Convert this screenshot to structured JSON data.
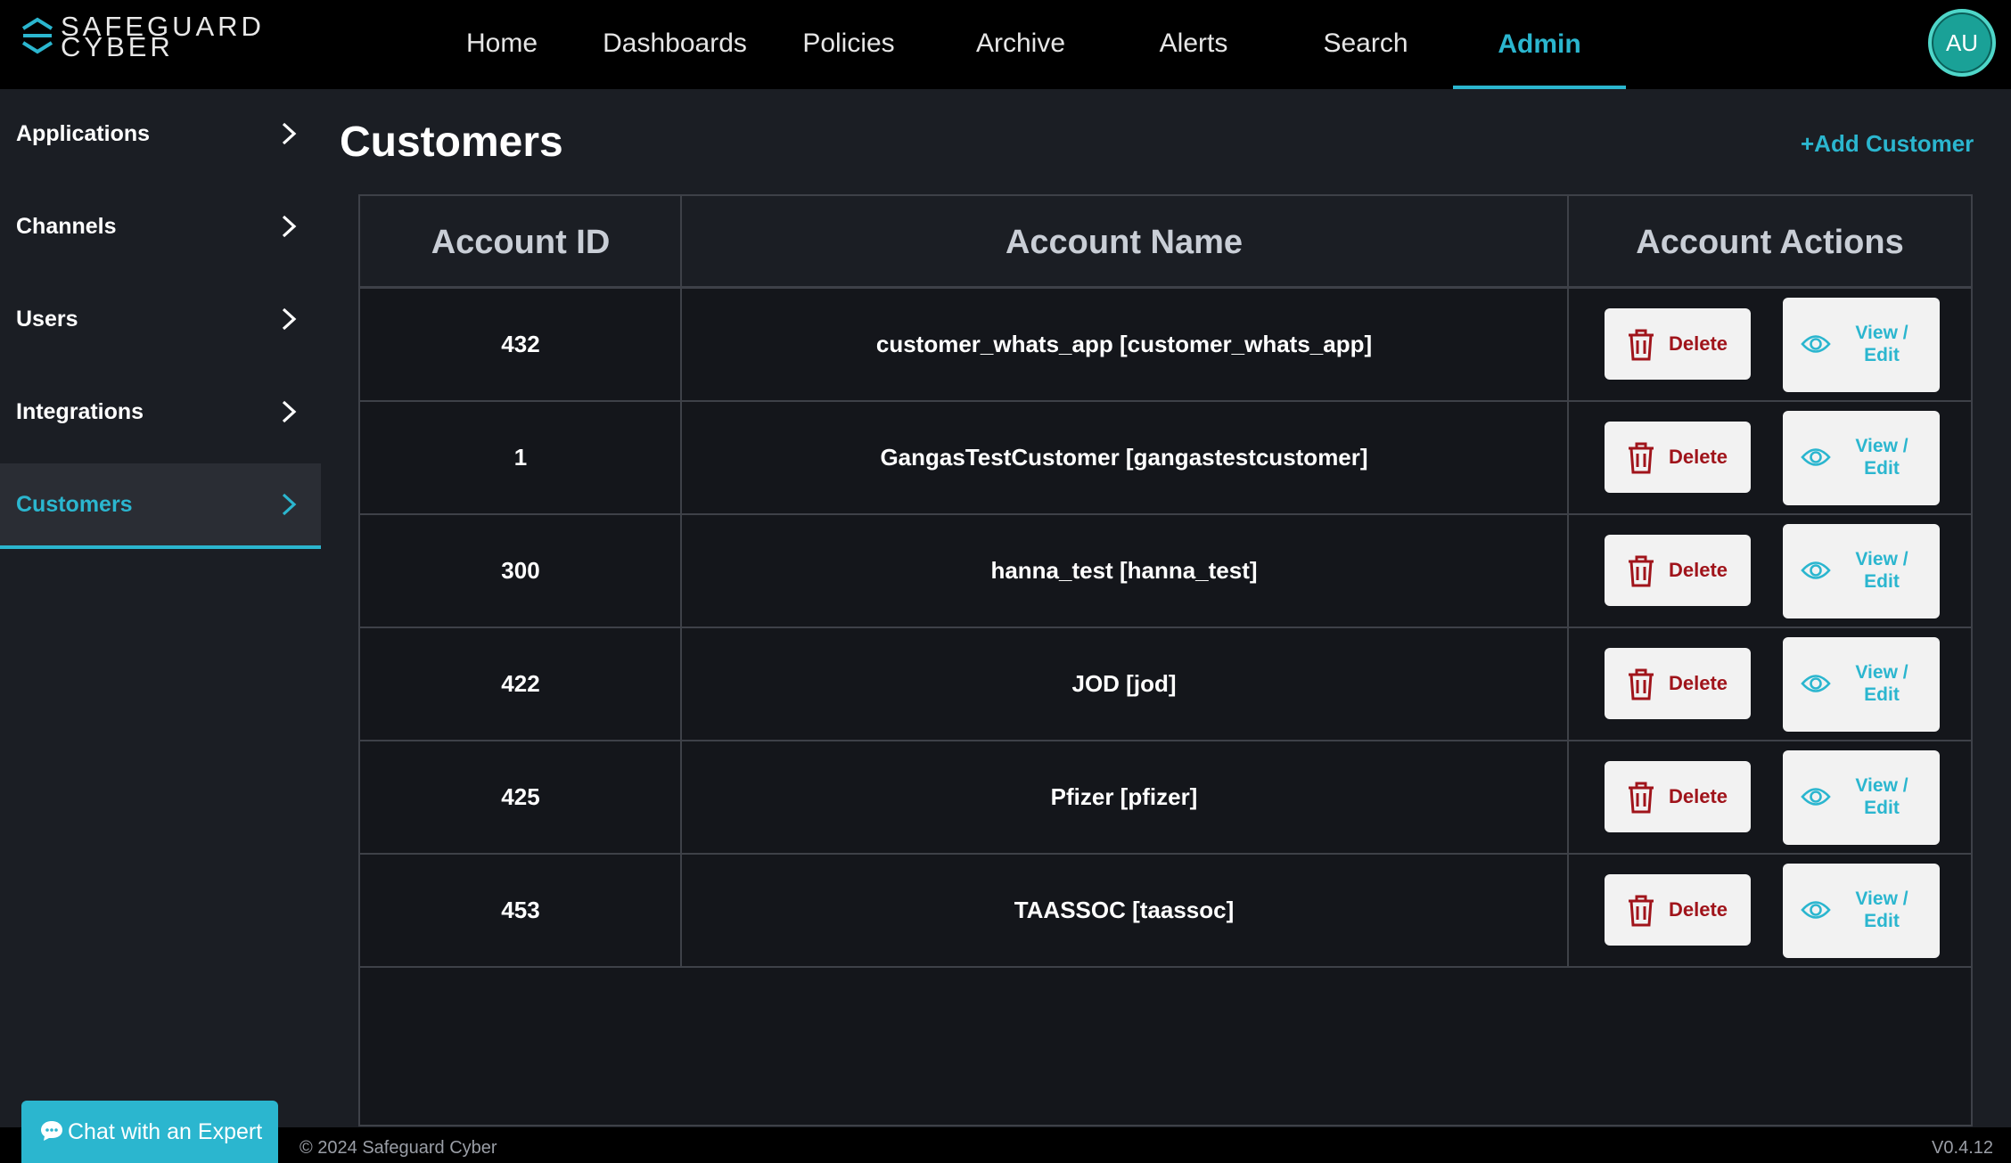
{
  "brand": {
    "logo_text_line1": "SAFEGUARD",
    "logo_text_line2": "CYBER",
    "accent_color": "#2bb6cf"
  },
  "nav": {
    "items": [
      {
        "label": "Home",
        "active": false
      },
      {
        "label": "Dashboards",
        "active": false
      },
      {
        "label": "Policies",
        "active": false
      },
      {
        "label": "Archive",
        "active": false
      },
      {
        "label": "Alerts",
        "active": false
      },
      {
        "label": "Search",
        "active": false
      },
      {
        "label": "Admin",
        "active": true
      }
    ],
    "avatar_initials": "AU"
  },
  "sidebar": {
    "items": [
      {
        "label": "Applications",
        "icon": "chevron-right-icon",
        "active": false
      },
      {
        "label": "Channels",
        "icon": "chevron-right-icon",
        "active": false
      },
      {
        "label": "Users",
        "icon": "chevron-right-icon",
        "active": false
      },
      {
        "label": "Integrations",
        "icon": "chevron-right-icon",
        "active": false
      },
      {
        "label": "Customers",
        "icon": "chevron-right-icon",
        "active": true
      }
    ]
  },
  "main": {
    "title": "Customers",
    "add_customer_label": "+Add Customer",
    "table": {
      "columns": [
        "Account ID",
        "Account Name",
        "Account Actions"
      ],
      "delete_label": "Delete",
      "view_edit_label": "View / Edit",
      "rows": [
        {
          "id": "432",
          "name": "customer_whats_app [customer_whats_app]"
        },
        {
          "id": "1",
          "name": "GangasTestCustomer [gangastestcustomer]"
        },
        {
          "id": "300",
          "name": "hanna_test [hanna_test]"
        },
        {
          "id": "422",
          "name": "JOD [jod]"
        },
        {
          "id": "425",
          "name": "Pfizer [pfizer]"
        },
        {
          "id": "453",
          "name": "TAASSOC [taassoc]"
        }
      ]
    }
  },
  "footer": {
    "copyright": "© 2024 Safeguard Cyber",
    "version": "V0.4.12",
    "chat_label": "Chat with an Expert"
  }
}
